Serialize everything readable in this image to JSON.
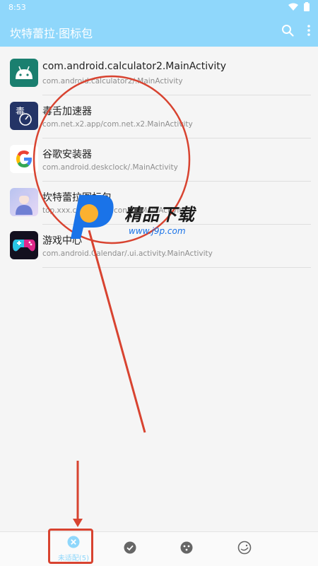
{
  "status": {
    "time": "8:53"
  },
  "appbar": {
    "title": "坎特蕾拉·图标包"
  },
  "list": [
    {
      "name": "com.android.calculator2.MainActivity",
      "pkg": "com.android.calculator2/.MainActivity",
      "icon": "android-icon"
    },
    {
      "name": "毒舌加速器",
      "pkg": "com.net.x2.app/com.net.x2.MainActivity",
      "icon": "speedometer-app-icon"
    },
    {
      "name": "谷歌安装器",
      "pkg": "com.android.deskclock/.MainActivity",
      "icon": "google-icon"
    },
    {
      "name": "坎特蕾拉图标包",
      "pkg": "top.xxx.cantarella.iconlib/.MainActivity",
      "icon": "anime-avatar-icon"
    },
    {
      "name": "游戏中心",
      "pkg": "com.android.Calendar/.ui.activity.MainActivity",
      "icon": "gamepad-icon"
    }
  ],
  "watermark": {
    "text": "精品下载",
    "url": "www.j9p.com"
  },
  "bottom_nav": [
    {
      "label": "未适配(5)",
      "icon": "close-circle-icon",
      "active": true
    },
    {
      "label": "",
      "icon": "check-circle-icon",
      "active": false
    },
    {
      "label": "",
      "icon": "palette-icon",
      "active": false
    },
    {
      "label": "",
      "icon": "moon-face-icon",
      "active": false
    }
  ],
  "colors": {
    "primary": "#8fd7fb",
    "annotation": "#d84330"
  }
}
